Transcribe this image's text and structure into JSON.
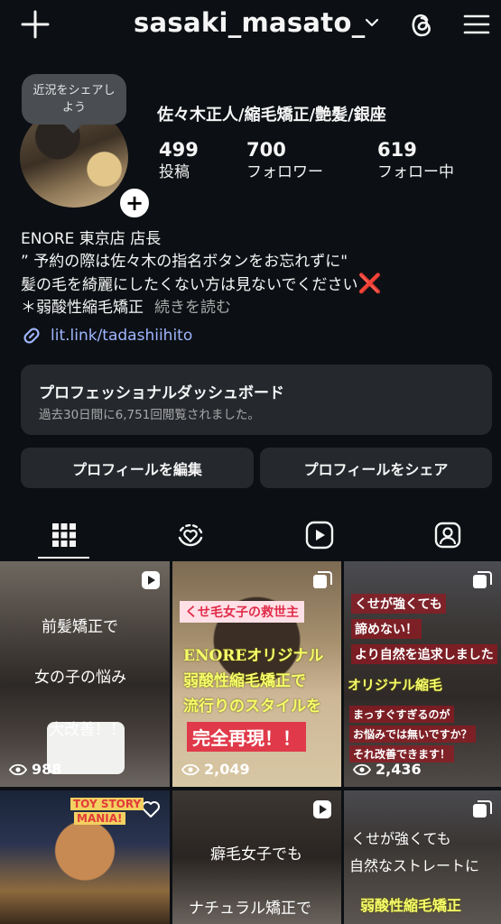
{
  "header": {
    "username": "sasaki_masato_",
    "icons": [
      "plus-icon",
      "chevron-down-icon",
      "threads-icon",
      "hamburger-menu-icon"
    ]
  },
  "profile": {
    "note_bubble": "近況をシェアしよう",
    "display_name": "佐々木正人/縮毛矯正/艶髪/銀座",
    "stats": [
      {
        "value": "499",
        "label": "投稿"
      },
      {
        "value": "700",
        "label": "フォロワー"
      },
      {
        "value": "619",
        "label": "フォロー中"
      }
    ],
    "bio_lines": [
      "ENORE 東京店 店長",
      "” 予約の際は佐々木の指名ボタンをお忘れずに\"",
      "髪の毛を綺麗にしたくない方は見ないでください",
      "＊弱酸性縮毛矯正"
    ],
    "bio_emoji": "❌",
    "more_label": "続きを読む",
    "link": "lit.link/tadashiihito"
  },
  "dashboard": {
    "title": "プロフェッショナルダッシュボード",
    "subtitle": "過去30日間に6,751回閲覧されました。"
  },
  "buttons": {
    "edit": "プロフィールを編集",
    "share": "プロフィールをシェア"
  },
  "tabs": [
    {
      "icon": "grid-icon",
      "active": true
    },
    {
      "icon": "reels-heart-icon",
      "active": false
    },
    {
      "icon": "play-icon",
      "active": false
    },
    {
      "icon": "tagged-person-icon",
      "active": false
    }
  ],
  "posts": [
    {
      "type": "reel",
      "captions": [
        "前髪矯正で",
        "女の子の悩み",
        "大改善！！"
      ],
      "views": "988"
    },
    {
      "type": "carousel",
      "captions": [
        "くせ毛女子の救世主",
        "ENOREオリジナル",
        "弱酸性縮毛矯正で",
        "流行りのスタイルを",
        "完全再現！！"
      ],
      "views": "2,049"
    },
    {
      "type": "carousel",
      "captions": [
        "くせが強くても",
        "諦めない！",
        "より自然を追求しました",
        "オリジナル縮毛",
        "まっすぐすぎるのが",
        "お悩みでは無いですか？",
        "それ改善できます！"
      ],
      "views": "2,436"
    },
    {
      "type": "heart",
      "captions": [
        "TOY STORY",
        "MANIA!"
      ]
    },
    {
      "type": "reel",
      "captions": [
        "癖毛女子でも",
        "ナチュラル矯正で"
      ]
    },
    {
      "type": "carousel",
      "captions": [
        "くせが強くても",
        "自然なストレートに",
        "弱酸性縮毛矯正"
      ]
    }
  ]
}
